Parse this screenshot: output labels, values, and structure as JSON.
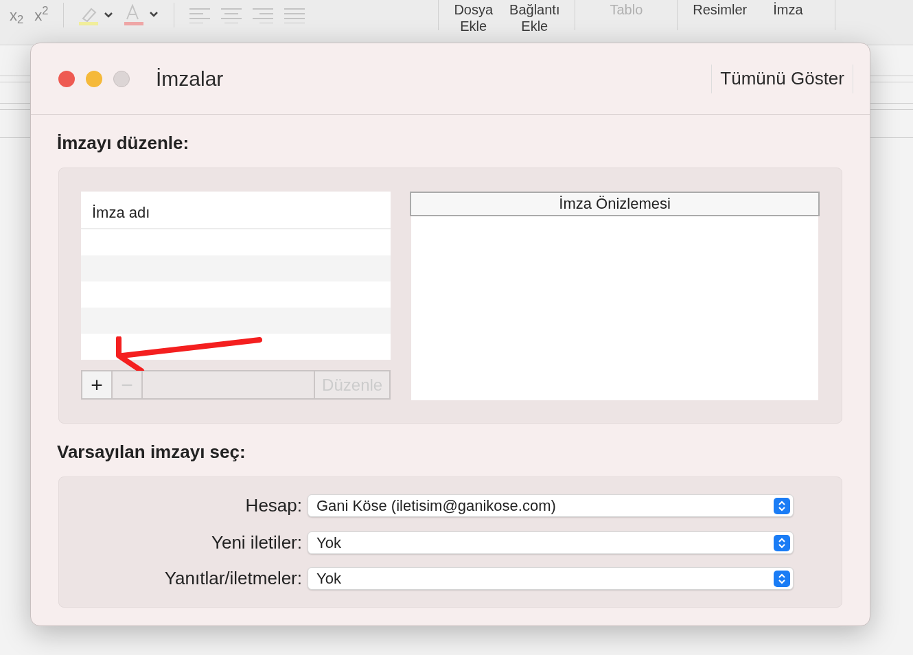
{
  "toolbar": {
    "format_buttons": [
      {
        "kind": "subscript",
        "label": "x$_{2}$"
      },
      {
        "kind": "superscript",
        "label": "x$^{2}$"
      },
      {
        "kind": "highlight"
      },
      {
        "kind": "font-color"
      },
      {
        "kind": "align-left"
      },
      {
        "kind": "align-center"
      },
      {
        "kind": "align-right"
      },
      {
        "kind": "justify"
      }
    ],
    "items": [
      {
        "label": "Dosya\nEkle",
        "disabled": false
      },
      {
        "label": "Bağlantı\nEkle",
        "disabled": false
      },
      {
        "label": "Tablo",
        "disabled": true
      },
      {
        "label": "Resimler",
        "disabled": false
      },
      {
        "label": "İmza",
        "disabled": false
      }
    ]
  },
  "window": {
    "title": "İmzalar",
    "show_all_button": "Tümünü Göster"
  },
  "edit_section": {
    "heading": "İmzayı düzenle:",
    "signature_list": {
      "column": "İmza adı"
    },
    "buttons": [
      {
        "kind": "add",
        "label": "+",
        "disabled": false
      },
      {
        "kind": "remove",
        "label": "−",
        "disabled": true
      },
      {
        "kind": "edit",
        "label": "Düzenle",
        "disabled": true
      }
    ],
    "preview": {
      "title": "İmza Önizlemesi"
    }
  },
  "default_section": {
    "heading": "Varsayılan imzayı seç:",
    "fields": [
      {
        "label": "Hesap:",
        "value": "Gani Köse (iletisim@ganikose.com)"
      },
      {
        "label": "Yeni iletiler:",
        "value": "Yok"
      },
      {
        "label": "Yanıtlar/iletmeler:",
        "value": "Yok"
      }
    ]
  }
}
